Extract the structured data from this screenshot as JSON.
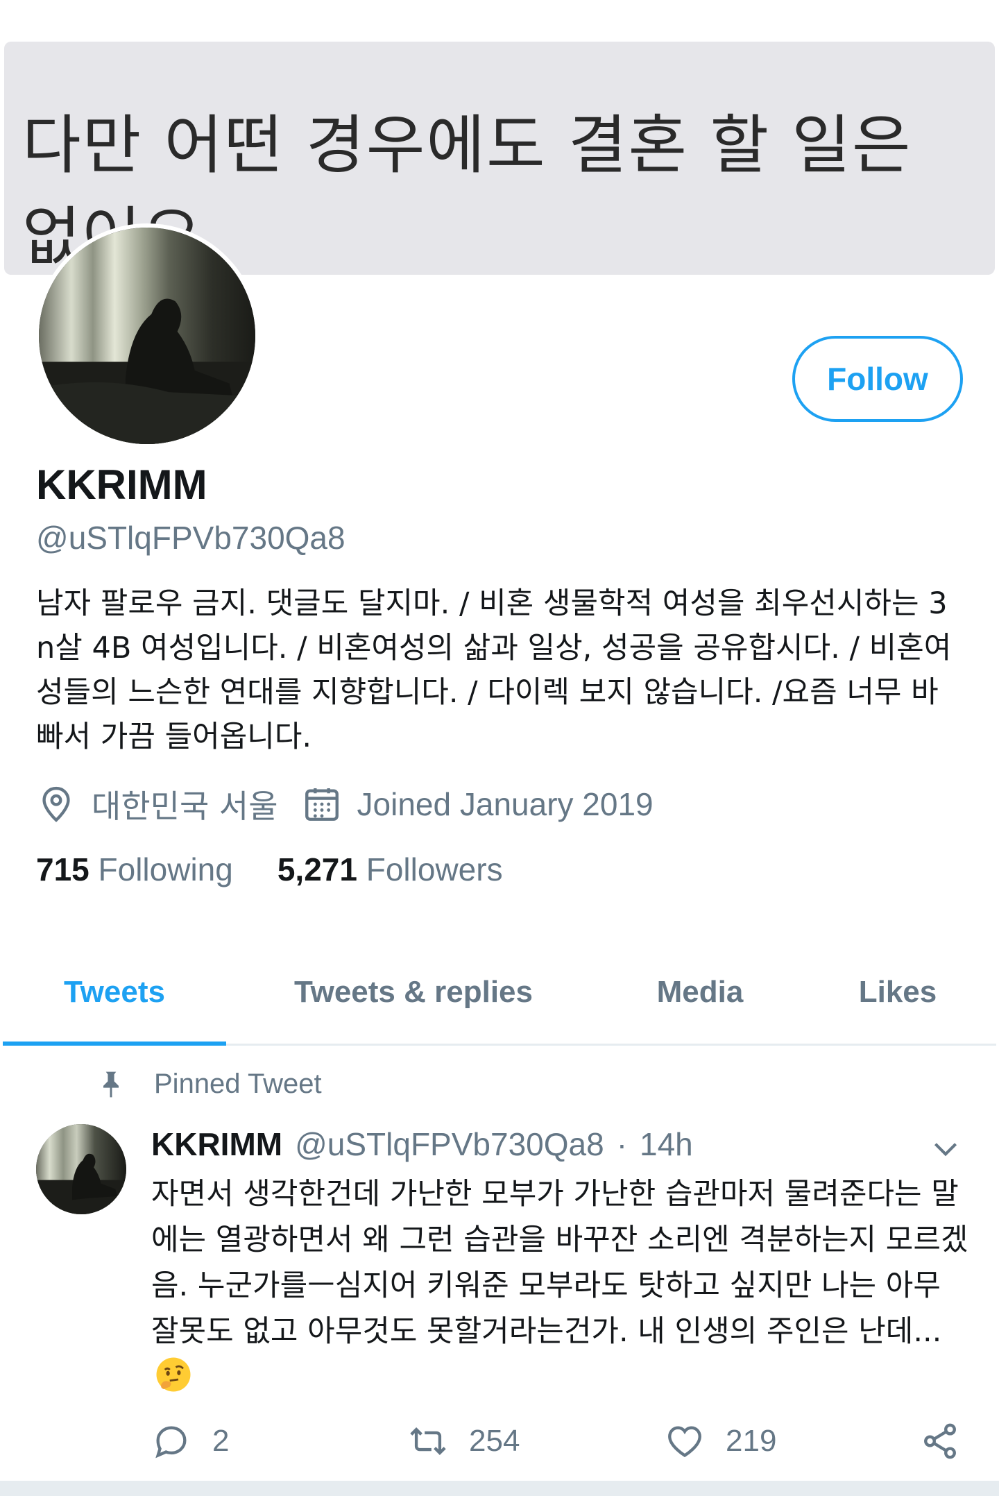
{
  "banner": {
    "text": "다만 어떤 경우에도 결혼 할 일은 없어요."
  },
  "profile": {
    "follow_label": "Follow",
    "display_name": "KKRIMM",
    "handle": "@uSTlqFPVb730Qa8",
    "bio": "남자 팔로우 금지. 댓글도 달지마. / 비혼 생물학적 여성을 최우선시하는 3n살 4B 여성입니다. / 비혼여성의 삶과 일상, 성공을 공유합시다. / 비혼여성들의 느슨한 연대를 지향합니다. / 다이렉 보지 않습니다. /요즘 너무 바빠서 가끔 들어옵니다.",
    "location": "대한민국 서울",
    "joined": "Joined January 2019",
    "location_icon": "location-pin-icon",
    "calendar_icon": "calendar-icon"
  },
  "stats": {
    "following_count": "715",
    "following_label": "Following",
    "followers_count": "5,271",
    "followers_label": "Followers"
  },
  "tabs": [
    {
      "label": "Tweets",
      "active": true
    },
    {
      "label": "Tweets & replies",
      "active": false
    },
    {
      "label": "Media",
      "active": false
    },
    {
      "label": "Likes",
      "active": false
    }
  ],
  "pinned_tweet": {
    "pinned_label": "Pinned Tweet",
    "author_name": "KKRIMM",
    "author_handle": "@uSTlqFPVb730Qa8",
    "separator": "·",
    "time": "14h",
    "text": "자면서 생각한건데 가난한 모부가 가난한 습관마저 물려준다는 말에는 열광하면서 왜 그런 습관을 바꾸잔 소리엔 격분하는지 모르겠음. 누군가를ㅡ심지어 키워준 모부라도 탓하고 싶지만 나는 아무 잘못도 없고 아무것도 못할거라는건가. 내 인생의 주인은 난데...",
    "emoji": "thinking-face-emoji",
    "reply_count": "2",
    "retweet_count": "254",
    "like_count": "219"
  },
  "colors": {
    "accent": "#1da1f2",
    "secondary_text": "#657786",
    "primary_text": "#14171a",
    "banner_bg": "#e6e6ea"
  }
}
